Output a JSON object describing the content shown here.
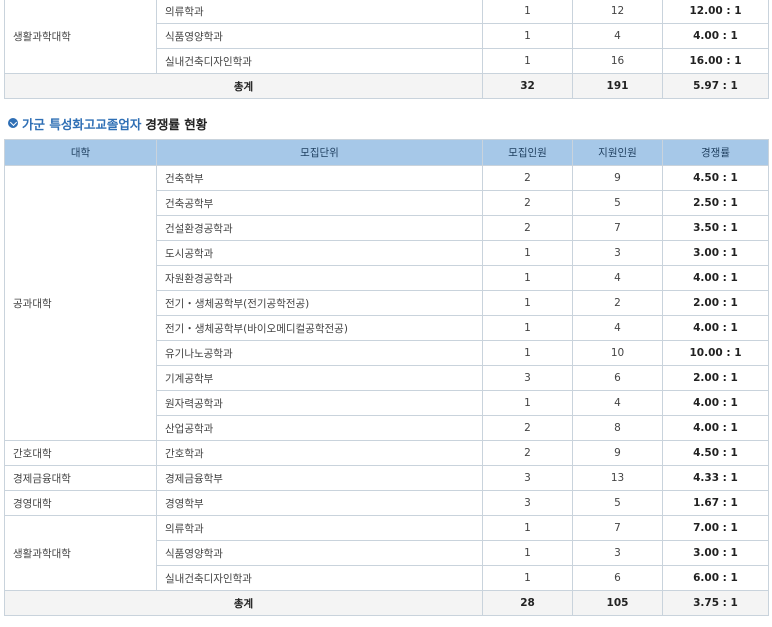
{
  "table1": {
    "college": "생활과학대학",
    "rows": [
      {
        "unit": "의류학과",
        "recruit": "1",
        "applicants": "12",
        "ratio": "12.00 : 1"
      },
      {
        "unit": "식품영양학과",
        "recruit": "1",
        "applicants": "4",
        "ratio": "4.00 : 1"
      },
      {
        "unit": "실내건축디자인학과",
        "recruit": "1",
        "applicants": "16",
        "ratio": "16.00 : 1"
      }
    ],
    "total": {
      "label": "총계",
      "recruit": "32",
      "applicants": "191",
      "ratio": "5.97 : 1"
    }
  },
  "section2": {
    "title_highlight": "가군 특성화고교졸업자",
    "title_rest": "경쟁률 현황",
    "headers": {
      "college": "대학",
      "unit": "모집단위",
      "recruit": "모집인원",
      "applicants": "지원인원",
      "ratio": "경쟁률"
    },
    "groups": [
      {
        "college": "공과대학",
        "rows": [
          {
            "unit": "건축학부",
            "recruit": "2",
            "applicants": "9",
            "ratio": "4.50 : 1"
          },
          {
            "unit": "건축공학부",
            "recruit": "2",
            "applicants": "5",
            "ratio": "2.50 : 1"
          },
          {
            "unit": "건설환경공학과",
            "recruit": "2",
            "applicants": "7",
            "ratio": "3.50 : 1"
          },
          {
            "unit": "도시공학과",
            "recruit": "1",
            "applicants": "3",
            "ratio": "3.00 : 1"
          },
          {
            "unit": "자원환경공학과",
            "recruit": "1",
            "applicants": "4",
            "ratio": "4.00 : 1"
          },
          {
            "unit": "전기・생체공학부(전기공학전공)",
            "recruit": "1",
            "applicants": "2",
            "ratio": "2.00 : 1"
          },
          {
            "unit": "전기・생체공학부(바이오메디컬공학전공)",
            "recruit": "1",
            "applicants": "4",
            "ratio": "4.00 : 1"
          },
          {
            "unit": "유기나노공학과",
            "recruit": "1",
            "applicants": "10",
            "ratio": "10.00 : 1"
          },
          {
            "unit": "기계공학부",
            "recruit": "3",
            "applicants": "6",
            "ratio": "2.00 : 1"
          },
          {
            "unit": "원자력공학과",
            "recruit": "1",
            "applicants": "4",
            "ratio": "4.00 : 1"
          },
          {
            "unit": "산업공학과",
            "recruit": "2",
            "applicants": "8",
            "ratio": "4.00 : 1"
          }
        ]
      },
      {
        "college": "간호대학",
        "rows": [
          {
            "unit": "간호학과",
            "recruit": "2",
            "applicants": "9",
            "ratio": "4.50 : 1"
          }
        ]
      },
      {
        "college": "경제금융대학",
        "rows": [
          {
            "unit": "경제금융학부",
            "recruit": "3",
            "applicants": "13",
            "ratio": "4.33 : 1"
          }
        ]
      },
      {
        "college": "경영대학",
        "rows": [
          {
            "unit": "경영학부",
            "recruit": "3",
            "applicants": "5",
            "ratio": "1.67 : 1"
          }
        ]
      },
      {
        "college": "생활과학대학",
        "rows": [
          {
            "unit": "의류학과",
            "recruit": "1",
            "applicants": "7",
            "ratio": "7.00 : 1"
          },
          {
            "unit": "식품영양학과",
            "recruit": "1",
            "applicants": "3",
            "ratio": "3.00 : 1"
          },
          {
            "unit": "실내건축디자인학과",
            "recruit": "1",
            "applicants": "6",
            "ratio": "6.00 : 1"
          }
        ]
      }
    ],
    "total": {
      "label": "총계",
      "recruit": "28",
      "applicants": "105",
      "ratio": "3.75 : 1"
    }
  }
}
